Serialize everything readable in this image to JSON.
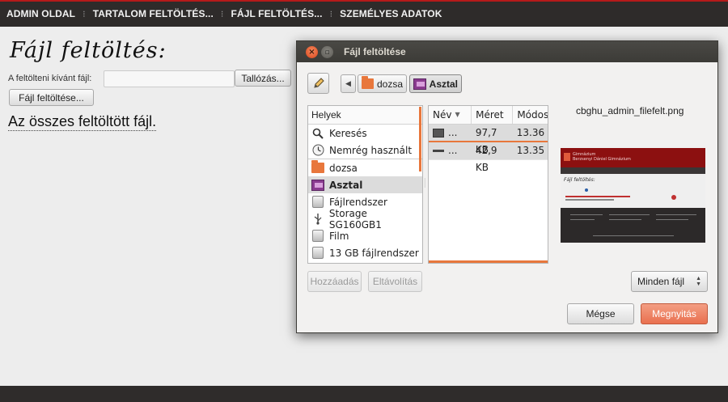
{
  "nav": {
    "items": [
      "ADMIN OLDAL",
      "TARTALOM FELTÖLTÉS...",
      "FÁJL FELTÖLTÉS...",
      "SZEMÉLYES ADATOK"
    ],
    "separator": "⁝"
  },
  "page": {
    "title": "Fájl feltöltés:",
    "file_label": "A feltölteni kívánt fájl:",
    "browse_label": "Tallózás...",
    "upload_label": "Fájl feltöltése...",
    "all_files_link": "Az összes feltöltött fájl."
  },
  "dialog": {
    "title": "Fájl feltöltése",
    "breadcrumbs": [
      "dozsa",
      "Asztal"
    ],
    "places_header": "Helyek",
    "places": [
      {
        "label": "Keresés",
        "icon": "search-icon"
      },
      {
        "label": "Nemrég használt",
        "icon": "clock-icon"
      },
      {
        "label": "dozsa",
        "icon": "home-folder-icon"
      },
      {
        "label": "Asztal",
        "icon": "desktop-icon"
      },
      {
        "label": "Fájlrendszer",
        "icon": "drive-icon"
      },
      {
        "label": "Storage SG160GB1",
        "icon": "usb-icon"
      },
      {
        "label": "Film",
        "icon": "drive-icon"
      },
      {
        "label": "13 GB fájlrendszer",
        "icon": "drive-icon"
      }
    ],
    "columns": {
      "name": "Név",
      "size": "Méret",
      "modified": "Módosít"
    },
    "files": [
      {
        "name": "...",
        "size": "97,7 KB",
        "modified": "13.36"
      },
      {
        "name": "...",
        "size": "42,9 KB",
        "modified": "13.35"
      }
    ],
    "preview_filename": "cbghu_admin_filefelt.png",
    "preview": {
      "brand_line1": "Gimnázium",
      "brand_line2": "Berzsenyi Dániel Gimnázium",
      "heading": "Fájl feltöltés:"
    },
    "add_label": "Hozzáadás",
    "remove_label": "Eltávolítás",
    "filter_label": "Minden fájl",
    "cancel_label": "Mégse",
    "open_label": "Megnyitás"
  }
}
